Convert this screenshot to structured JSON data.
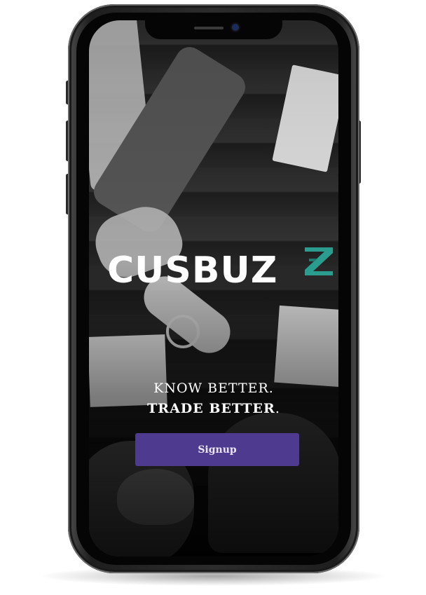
{
  "app": {
    "logo_text": "CUSBUZ",
    "logo_mark_color": "#2a9d8f",
    "tagline_line1": "KNOW BETTER.",
    "tagline_line2_bold": "TRADE BETTER",
    "tagline_line2_suffix": ".",
    "signup_label": "Signup",
    "signup_color": "#4e3a8e"
  },
  "device": {
    "model_icon": "smartphone-icon"
  }
}
